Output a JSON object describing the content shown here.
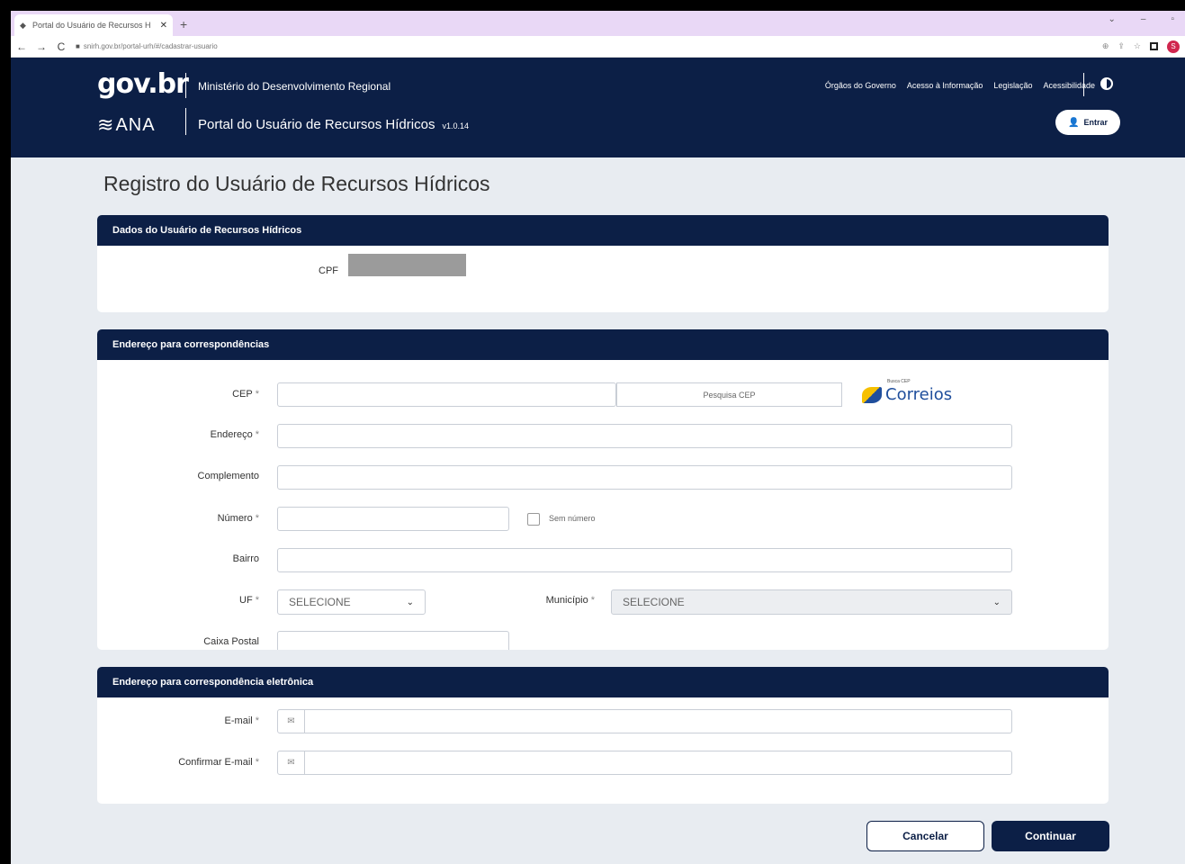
{
  "browser": {
    "tab_title": "Portal do Usuário de Recursos H",
    "tab_favicon": "◆",
    "tab_close": "✕",
    "new_tab": "+",
    "window_controls": [
      "⌄",
      "–",
      "▫"
    ],
    "nav_back": "←",
    "nav_forward": "→",
    "nav_reload": "C",
    "url": "snirh.gov.br/portal-urh/#/cadastrar-usuario",
    "profile_initial": "S"
  },
  "header": {
    "gov_logo": "gov.br",
    "ministry": "Ministério do Desenvolvimento Regional",
    "nav_links": [
      "Órgãos do Governo",
      "Acesso à Informação",
      "Legislação",
      "Acessibilidade"
    ],
    "ana_logo": "ANA",
    "portal_title": "Portal do Usuário de Recursos Hídricos",
    "version": "v1.0.14",
    "enter_label": "Entrar"
  },
  "page": {
    "title": "Registro do Usuário de Recursos Hídricos"
  },
  "section_user": {
    "header": "Dados do Usuário de Recursos Hídricos",
    "cpf_label": "CPF"
  },
  "section_address": {
    "header": "Endereço para correspondências",
    "required_mark": "*",
    "cep_label": "CEP",
    "cep_search": "Pesquisa CEP",
    "correios_sub": "Busca CEP",
    "correios": "Correios",
    "endereco_label": "Endereço",
    "complemento_label": "Complemento",
    "numero_label": "Número",
    "sem_numero_label": "Sem número",
    "bairro_label": "Bairro",
    "uf_label": "UF",
    "uf_value": "SELECIONE",
    "municipio_label": "Município",
    "municipio_value": "SELECIONE",
    "caixa_postal_label": "Caixa Postal"
  },
  "section_email": {
    "header": "Endereço para correspondência eletrônica",
    "email_label": "E-mail",
    "confirm_label": "Confirmar E-mail"
  },
  "actions": {
    "cancel": "Cancelar",
    "continue": "Continuar"
  }
}
